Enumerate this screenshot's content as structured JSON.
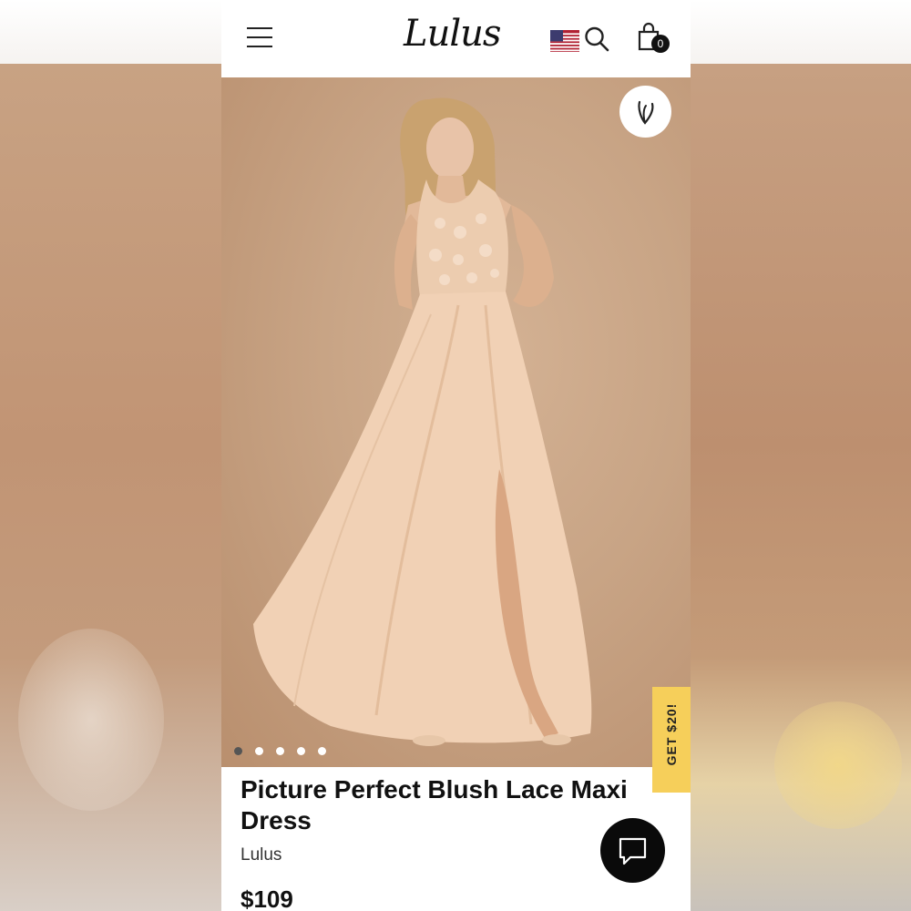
{
  "header": {
    "logo_text": "Lulus",
    "cart_count": "0",
    "menu_icon": "hamburger-menu-icon",
    "flag_icon": "us-flag-icon",
    "search_icon": "search-icon",
    "cart_icon": "shopping-bag-icon"
  },
  "gallery": {
    "image_count": 5,
    "active_index": 0,
    "wishlist_icon": "heart-icon"
  },
  "promo": {
    "label": "GET $20!"
  },
  "product": {
    "name": "Picture Perfect Blush Lace Maxi Dress",
    "brand": "Lulus",
    "price": "$109"
  },
  "chat": {
    "icon": "chat-bubble-icon"
  },
  "colors": {
    "promo_bg": "#f6cf5a",
    "background_blur": "#c9a07f",
    "dress": "#f1d1b5"
  }
}
